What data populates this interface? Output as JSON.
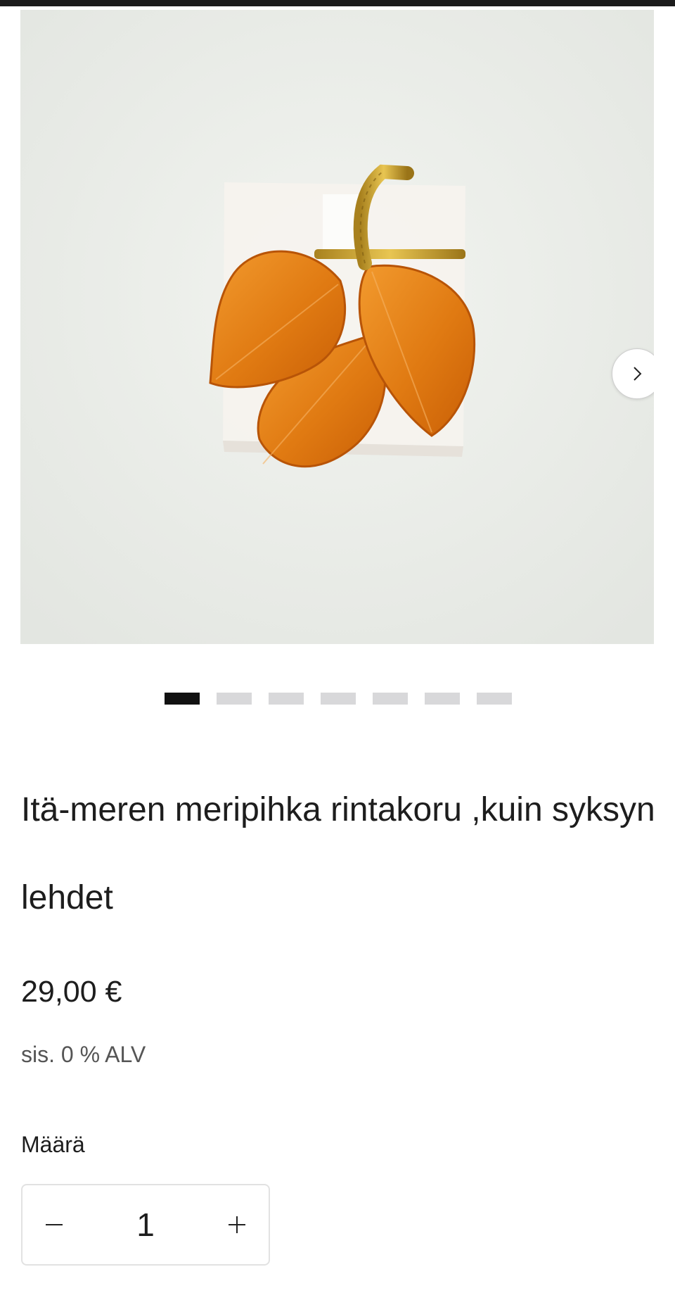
{
  "gallery": {
    "image_alt": "Itä-meren meripihka rintakoru ,kuin syksyn lehdet",
    "next_icon": "chevron-right-icon",
    "slide_count": 7,
    "active_slide": 1
  },
  "product": {
    "title": "Itä-meren meripihka rintakoru ,kuin syksyn lehdet",
    "price": "29,00 €",
    "vat_note": "sis. 0 % ALV"
  },
  "quantity": {
    "label": "Määrä",
    "value": "1",
    "decrease_icon": "minus-icon",
    "increase_icon": "plus-icon"
  },
  "colors": {
    "accent": "#111111",
    "inactive_dot": "#d8d8da",
    "amber": "#e07a12"
  }
}
